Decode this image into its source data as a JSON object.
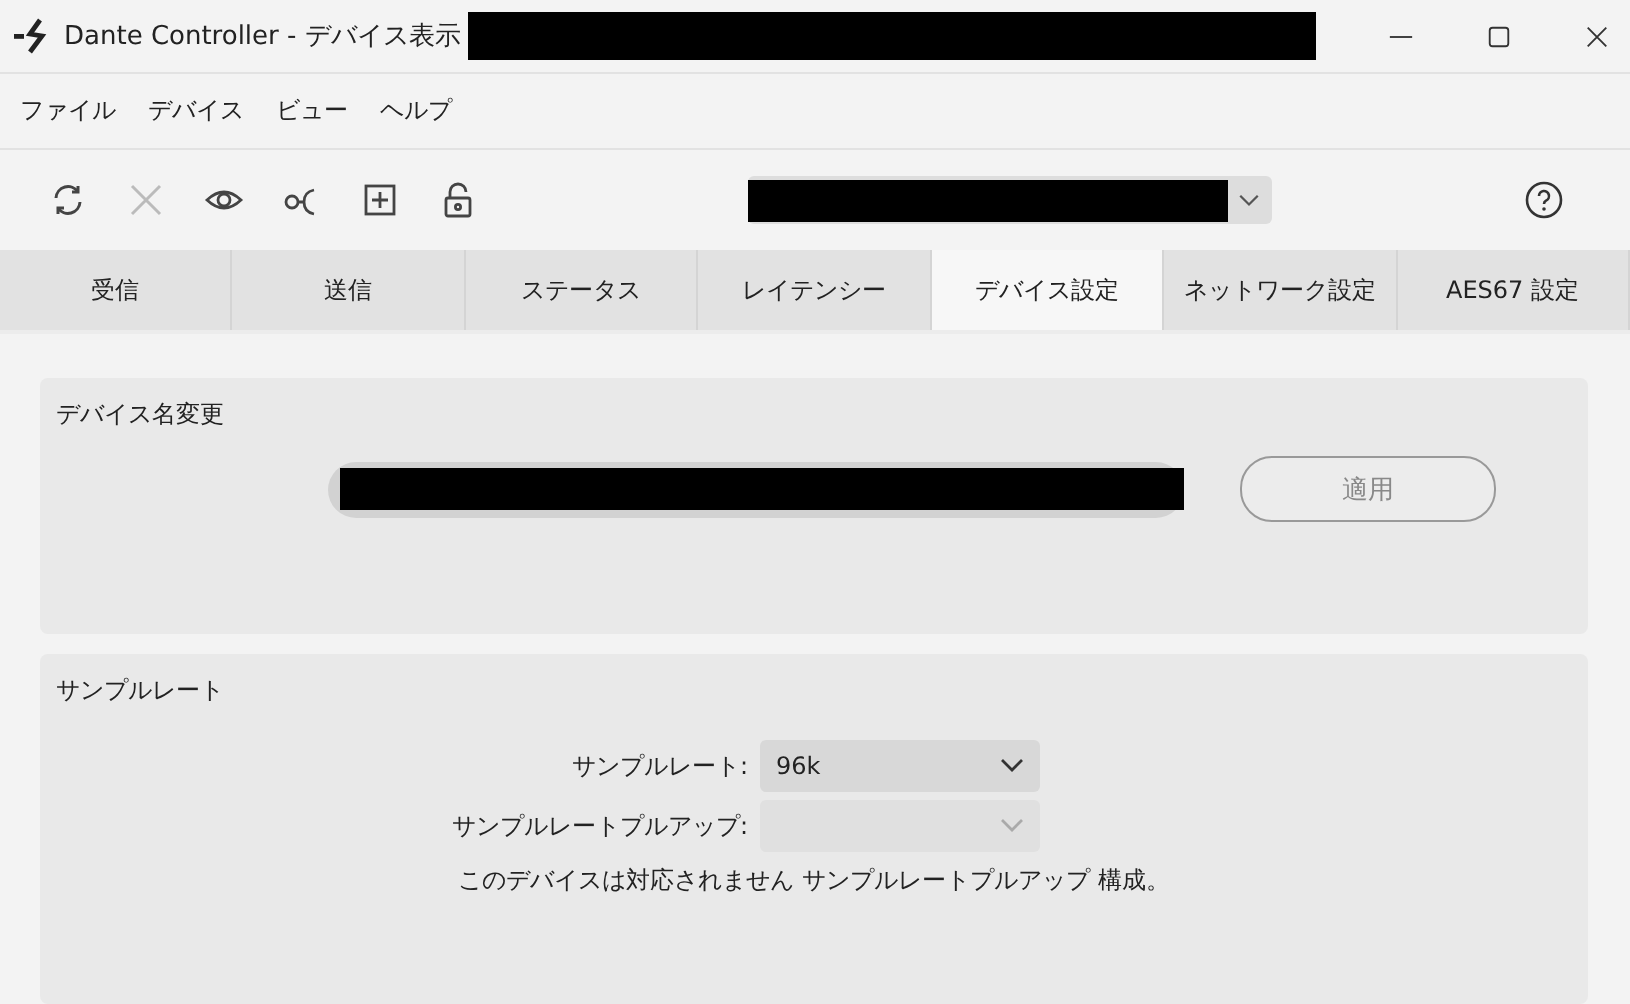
{
  "window": {
    "title": "Dante Controller - デバイス表示"
  },
  "menu": [
    "ファイル",
    "デバイス",
    "ビュー",
    "ヘルプ"
  ],
  "toolbar": [
    {
      "kind": "refresh",
      "disabled": false
    },
    {
      "kind": "disconnect",
      "disabled": true
    },
    {
      "kind": "view",
      "disabled": false
    },
    {
      "kind": "network",
      "disabled": false
    },
    {
      "kind": "add",
      "disabled": false
    },
    {
      "kind": "lock",
      "disabled": false
    }
  ],
  "tabs": [
    {
      "label": "受信",
      "selected": false
    },
    {
      "label": "送信",
      "selected": false
    },
    {
      "label": "ステータス",
      "selected": false
    },
    {
      "label": "レイテンシー",
      "selected": false
    },
    {
      "label": "デバイス設定",
      "selected": true
    },
    {
      "label": "ネットワーク設定",
      "selected": false
    },
    {
      "label": "AES67 設定",
      "selected": false
    }
  ],
  "rename_panel": {
    "title": "デバイス名変更",
    "apply_button": {
      "label": "適用",
      "disabled": true
    }
  },
  "sample_rate_panel": {
    "title": "サンプルレート",
    "fields": [
      {
        "label": "サンプルレート:",
        "value": "96k",
        "disabled": false
      },
      {
        "label": "サンプルレートプルアップ:",
        "disabled": true
      }
    ],
    "note": "このデバイスは対応されません サンプルレートプルアップ 構成。"
  }
}
